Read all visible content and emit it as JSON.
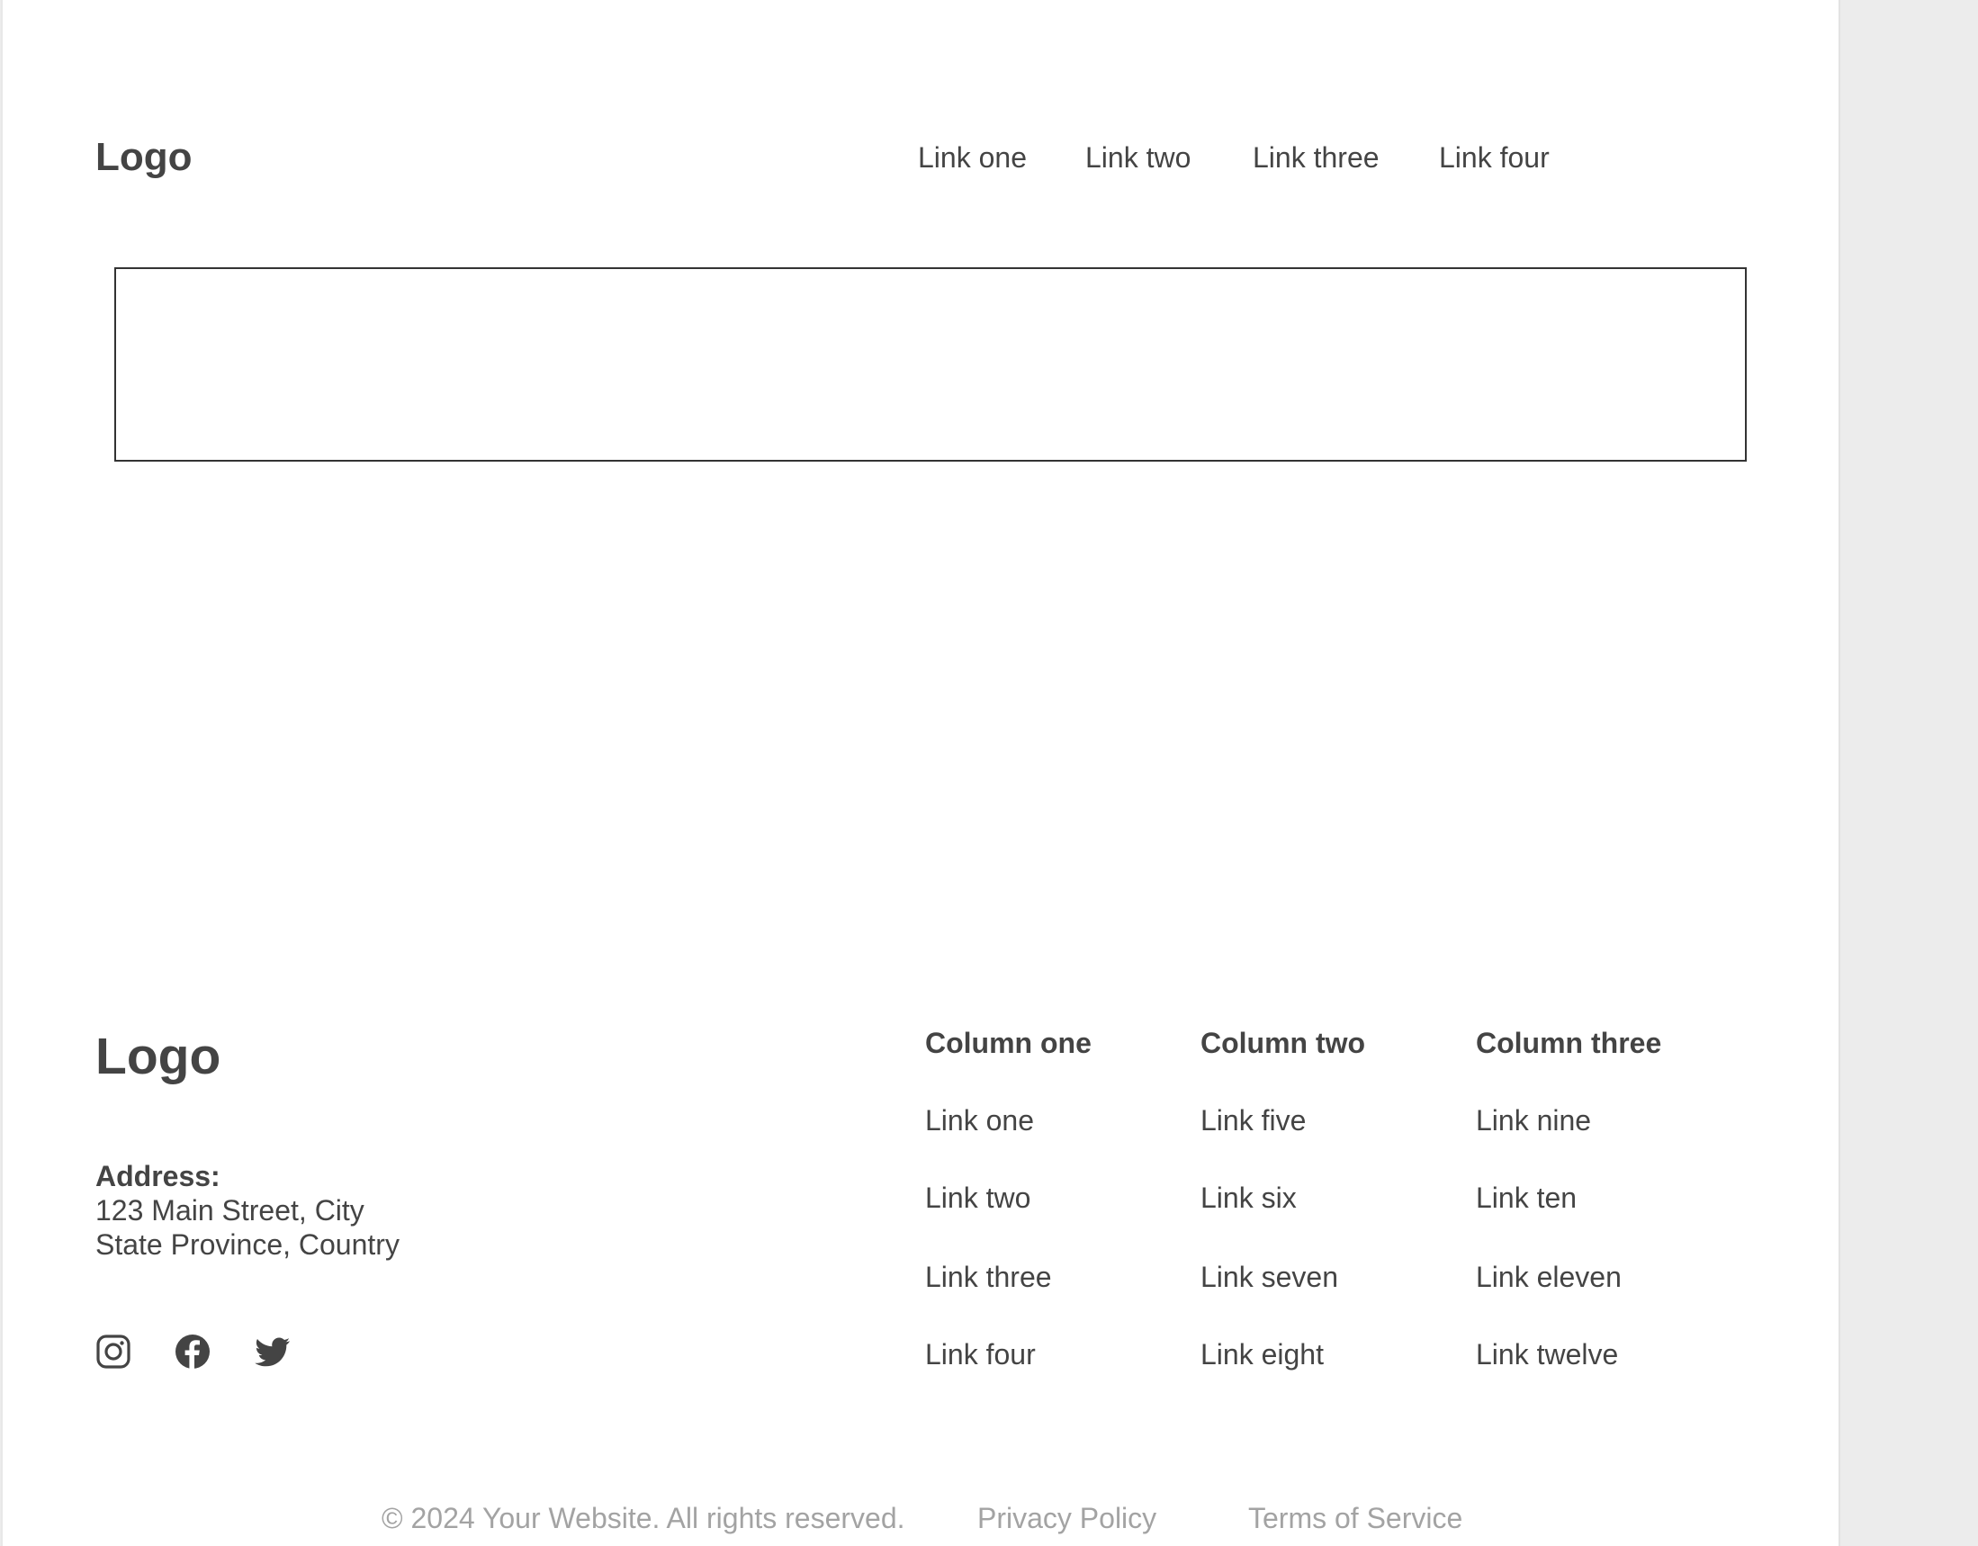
{
  "header": {
    "logo": "Logo",
    "nav": [
      "Link one",
      "Link two",
      "Link three",
      "Link four"
    ]
  },
  "footer": {
    "logo": "Logo",
    "address": {
      "label": "Address:",
      "line1": "123 Main Street, City",
      "line2": "State Province, Country"
    },
    "social_icons": [
      "instagram-icon",
      "facebook-icon",
      "twitter-icon"
    ],
    "columns": [
      {
        "title": "Column one",
        "links": [
          "Link one",
          "Link two",
          "Link three",
          "Link four"
        ]
      },
      {
        "title": "Column two",
        "links": [
          "Link five",
          "Link six",
          "Link seven",
          "Link eight"
        ]
      },
      {
        "title": "Column three",
        "links": [
          "Link nine",
          "Link ten",
          "Link eleven",
          "Link twelve"
        ]
      }
    ],
    "copyright": "© 2024 Your Website. All rights reserved.",
    "privacy": "Privacy Policy",
    "terms": "Terms of Service"
  },
  "colors": {
    "text": "#444444",
    "muted": "#a3a3a3",
    "border": "#333333",
    "background": "#ffffff",
    "outside": "#ececec"
  }
}
